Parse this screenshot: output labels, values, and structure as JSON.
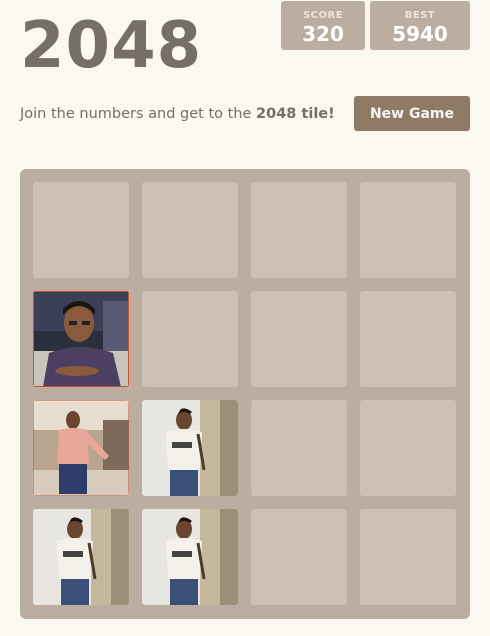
{
  "title": "2048",
  "score": {
    "label": "SCORE",
    "value": "320"
  },
  "best": {
    "label": "BEST",
    "value": "5940"
  },
  "intro": {
    "prefix": "Join the numbers and get to the ",
    "highlight": "2048 tile!"
  },
  "new_game_label": "New Game",
  "board": {
    "rows": 4,
    "cols": 4,
    "tiles": [
      {
        "row": 1,
        "col": 0,
        "photo": "man-purple-shirt-selfie"
      },
      {
        "row": 2,
        "col": 0,
        "photo": "man-pink-shirt-standing"
      },
      {
        "row": 2,
        "col": 1,
        "photo": "man-white-tshirt-doorway"
      },
      {
        "row": 3,
        "col": 0,
        "photo": "man-white-tshirt-doorway"
      },
      {
        "row": 3,
        "col": 1,
        "photo": "man-white-tshirt-doorway"
      }
    ]
  },
  "colors": {
    "background": "#faf8ef",
    "board": "#bbada0",
    "text": "#776e65",
    "button": "#8f7a66"
  }
}
